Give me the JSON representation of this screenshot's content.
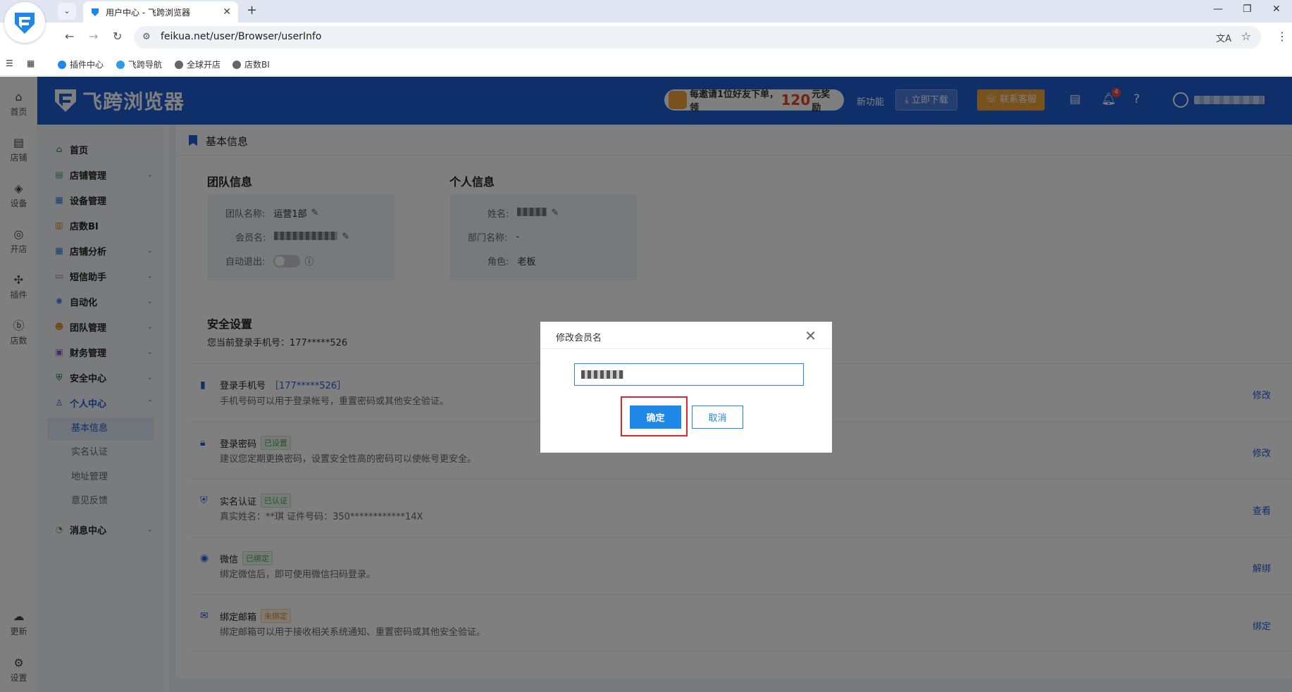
{
  "browser": {
    "tab_title": "用户中心 - 飞跨浏览器",
    "url": "feikua.net/user/Browser/userInfo",
    "bookmarks": [
      "插件中心",
      "飞跨导航",
      "全球开店",
      "店数BI"
    ]
  },
  "rail": {
    "items": [
      "首页",
      "店铺",
      "设备",
      "开店",
      "插件",
      "店数"
    ],
    "bottom": [
      "更新",
      "设置"
    ]
  },
  "header": {
    "brand": "飞跨浏览器",
    "promo_prefix": "每邀请1位好友下单，领",
    "promo_amount": "120",
    "promo_suffix": "元奖励",
    "new_feature": "新功能",
    "download": "立即下载",
    "support": "联系客服",
    "notif_count": "4"
  },
  "menu": {
    "items": [
      "首页",
      "店铺管理",
      "设备管理",
      "店数BI",
      "店铺分析",
      "短信助手",
      "自动化",
      "团队管理",
      "财务管理",
      "安全中心",
      "个人中心",
      "消息中心"
    ],
    "submenu": [
      "基本信息",
      "实名认证",
      "地址管理",
      "意见反馈"
    ]
  },
  "page": {
    "section_title": "基本信息",
    "team": {
      "title": "团队信息",
      "name_label": "团队名称:",
      "name_value": "运营1部",
      "member_label": "会员名:",
      "auto_logout_label": "自动退出:"
    },
    "personal": {
      "title": "个人信息",
      "name_label": "姓名:",
      "dept_label": "部门名称:",
      "dept_value": "-",
      "role_label": "角色:",
      "role_value": "老板"
    },
    "security": {
      "title": "安全设置",
      "subtitle": "您当前登录手机号：177*****526",
      "rows": [
        {
          "name": "登录手机号",
          "extra": "［177*****526］",
          "tag": "",
          "desc": "手机号码可以用于登录帐号，重置密码或其他安全验证。",
          "action": "修改"
        },
        {
          "name": "登录密码",
          "extra": "",
          "tag": "已设置",
          "desc": "建议您定期更换密码，设置安全性高的密码可以使帐号更安全。",
          "action": "修改"
        },
        {
          "name": "实名认证",
          "extra": "",
          "tag": "已认证",
          "desc": "真实姓名：**琪      证件号码：350************14X",
          "action": "查看"
        },
        {
          "name": "微信",
          "extra": "",
          "tag": "已绑定",
          "desc": "绑定微信后，即可使用微信扫码登录。",
          "action": "解绑"
        },
        {
          "name": "绑定邮箱",
          "extra": "",
          "tag": "未绑定",
          "desc": "绑定邮箱可以用于接收相关系统通知、重置密码或其他安全验证。",
          "action": "绑定"
        }
      ]
    }
  },
  "dialog": {
    "title": "修改会员名",
    "confirm": "确定",
    "cancel": "取消"
  },
  "colors": {
    "brand_blue": "#1f5fd6",
    "button_blue": "#1f87e8",
    "highlight_red": "#e0262d"
  }
}
